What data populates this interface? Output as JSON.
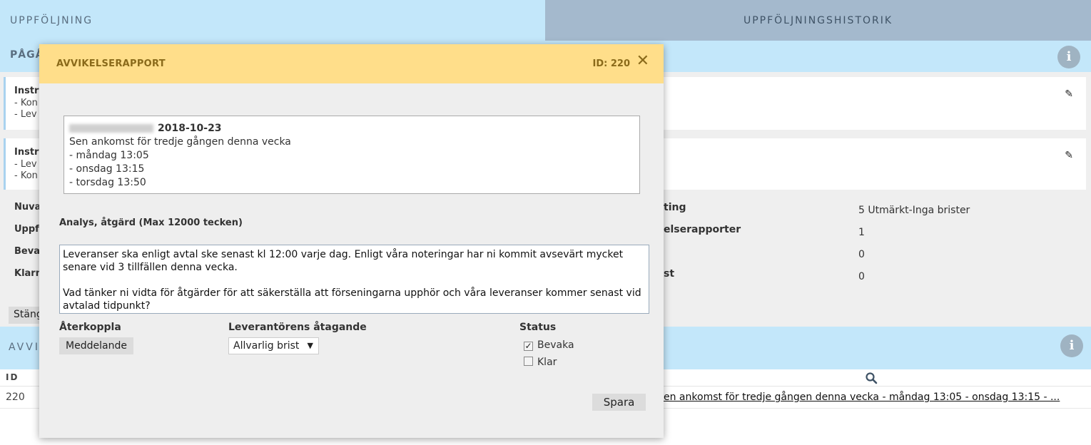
{
  "tabs": {
    "left": "UPPFÖLJNING",
    "right": "UPPFÖLJNINGSHISTORIK"
  },
  "section1": {
    "title": "PÅGÅ"
  },
  "cards": [
    {
      "title": "Instr",
      "lines": [
        "- Kon",
        "- Lev"
      ]
    },
    {
      "title": "Instr",
      "lines": [
        "- Lev",
        "- Kon"
      ]
    }
  ],
  "fields_left": [
    "Nuva",
    "Uppf",
    "Beva",
    "Klarm"
  ],
  "fields_right": {
    "labels": [
      "ting",
      "elserapporter",
      "",
      "st"
    ],
    "values": [
      "5 Utmärkt-Inga brister",
      "1",
      "0",
      "0"
    ]
  },
  "close_button": "Stäng",
  "section2": {
    "title": "AVVI"
  },
  "table": {
    "header_id": "ID",
    "row": {
      "id": "220",
      "text": "en ankomst för tredje gången denna vecka - måndag 13:05 - onsdag 13:15 - ..."
    }
  },
  "modal": {
    "title": "AVVIKELSERAPPORT",
    "id_label": "ID: 220",
    "close_glyph": "✕",
    "report": {
      "date": "2018-10-23",
      "lines": [
        "Sen ankomst för tredje gången denna vecka",
        "- måndag 13:05",
        "- onsdag 13:15",
        "- torsdag 13:50"
      ]
    },
    "analysis_label": "Analys, åtgärd (Max 12000 tecken)",
    "analysis_text": "Leveranser ska enligt avtal ske senast kl 12:00 varje dag. Enligt våra noteringar har ni kommit avsevärt mycket senare vid 3 tillfällen denna vecka.\n\nVad tänker ni vidta för åtgärder för att säkerställa att förseningarna upphör och våra leveranser kommer senast vid avtalad tidpunkt?",
    "feedback_label": "Återkoppla",
    "message_button": "Meddelande",
    "commitment_label": "Leverantörens åtagande",
    "commitment_selected": "Allvarlig brist",
    "status_label": "Status",
    "status_options": [
      {
        "label": "Bevaka",
        "checked": true
      },
      {
        "label": "Klar",
        "checked": false
      }
    ],
    "save_button": "Spara"
  }
}
